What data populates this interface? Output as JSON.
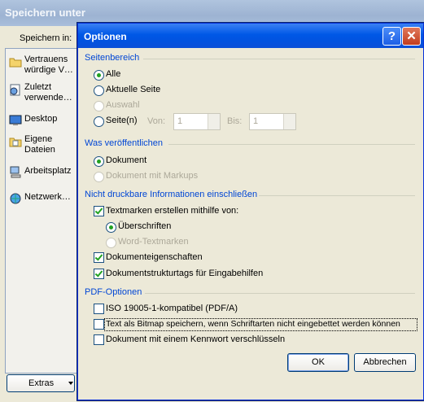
{
  "background_window": {
    "title": "Speichern unter",
    "save_in_label": "Speichern in:",
    "places": [
      {
        "label": "Vertrauens würdige V…",
        "icon": "folder-icon"
      },
      {
        "label": "Zuletzt verwende…",
        "icon": "recent-documents-icon"
      },
      {
        "label": "Desktop",
        "icon": "desktop-icon"
      },
      {
        "label": "Eigene Dateien",
        "icon": "my-documents-icon"
      },
      {
        "label": "Arbeitsplatz",
        "icon": "my-computer-icon"
      },
      {
        "label": "Netzwerk…",
        "icon": "network-icon"
      }
    ],
    "extras_label": "Extras"
  },
  "dialog": {
    "title": "Optionen",
    "help_symbol": "?",
    "close_symbol": "✕",
    "page_range": {
      "heading": "Seitenbereich",
      "all": "Alle",
      "current_page": "Aktuelle Seite",
      "selection": "Auswahl",
      "pages": "Seite(n)",
      "from_label": "Von:",
      "from_value": "1",
      "to_label": "Bis:",
      "to_value": "1"
    },
    "publish_what": {
      "heading": "Was veröffentlichen",
      "document": "Dokument",
      "document_markup": "Dokument mit Markups"
    },
    "non_printing": {
      "heading": "Nicht druckbare Informationen einschließen",
      "bookmarks": "Textmarken erstellen mithilfe von:",
      "headings": "Überschriften",
      "word_bookmarks": "Word-Textmarken",
      "doc_properties": "Dokumenteigenschaften",
      "structure_tags": "Dokumentstrukturtags für Eingabehilfen"
    },
    "pdf_options": {
      "heading": "PDF-Optionen",
      "iso": "ISO 19005-1-kompatibel (PDF/A)",
      "bitmap": "Text als Bitmap speichern, wenn Schriftarten nicht eingebettet werden können",
      "encrypt": "Dokument mit einem Kennwort verschlüsseln"
    },
    "ok": "OK",
    "cancel": "Abbrechen"
  }
}
